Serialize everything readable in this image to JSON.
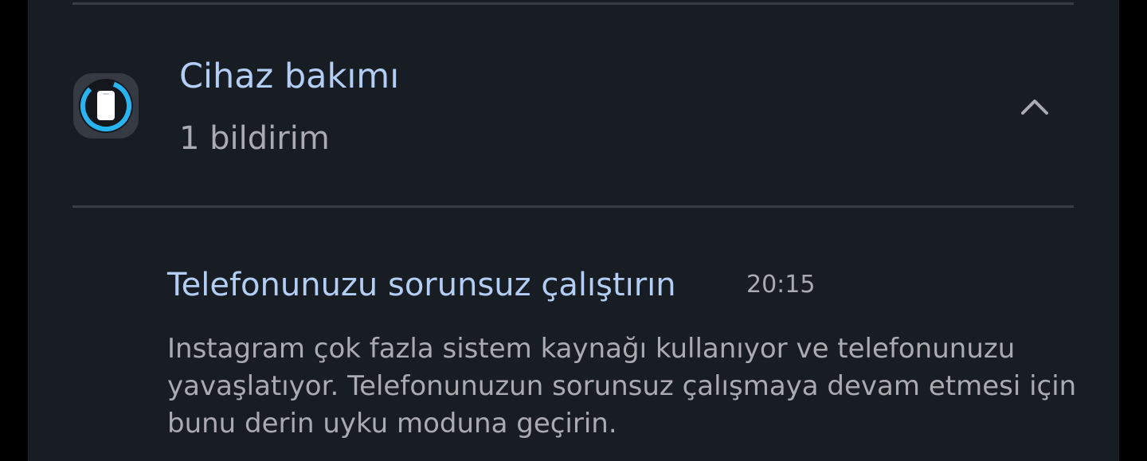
{
  "group": {
    "app_name": "Cihaz bakımı",
    "count_label": "1 bildirim",
    "icon": "device-care-icon",
    "collapse_icon": "chevron-up-icon"
  },
  "notification": {
    "title": "Telefonunuzu sorunsuz çalıştırın",
    "time": "20:15",
    "body_lines": [
      "Instagram çok fazla sistem kaynağı kullanıyor ve telefonunuzu",
      "yavaşlatıyor. Telefonunuzun sorunsuz çalışmaya devam etmesi için",
      "bunu derin uyku moduna geçirin."
    ]
  },
  "colors": {
    "background": "#181c23",
    "accent_text": "#b2cef4",
    "secondary_text": "#a9abb0",
    "icon_ring": "#28b4f0",
    "divider": "#383c43"
  }
}
